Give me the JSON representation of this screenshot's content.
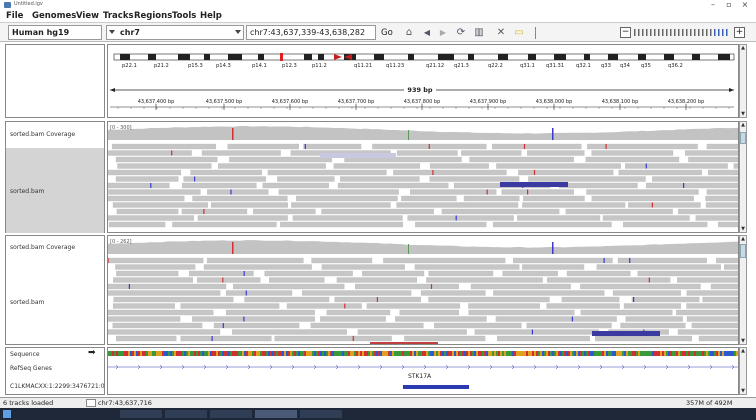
{
  "window": {
    "title": "Untitled.igv"
  },
  "menu": [
    "File",
    "Genomes",
    "View",
    "Tracks",
    "Regions",
    "Tools",
    "Help"
  ],
  "toolbar": {
    "genome": "Human hg19",
    "chromosome": "chr7",
    "locus": "chr7:43,637,339-43,638,282",
    "go_label": "Go"
  },
  "ideogram": {
    "bands": [
      "p22.1",
      "p21.2",
      "p15.3",
      "p14.3",
      "p14.1",
      "p12.3",
      "p11.2",
      "q11.21",
      "q11.23",
      "q21.12",
      "q21.3",
      "q22.2",
      "q31.1",
      "q31.31",
      "q32.1",
      "q33",
      "q34",
      "q35",
      "q36.2"
    ]
  },
  "ruler": {
    "span": "939 bp",
    "ticks": [
      "43,637,400 bp",
      "43,637,500 bp",
      "43,637,600 bp",
      "43,637,700 bp",
      "43,637,800 bp",
      "43,637,900 bp",
      "43,638,000 bp",
      "43,638,100 bp",
      "43,638,200 bp"
    ]
  },
  "panels": [
    {
      "coverage_label": "sorted.bam Coverage",
      "range": "[0 - 300]",
      "alignments_label": "sorted.bam"
    },
    {
      "coverage_label": "sorted.bam Coverage",
      "range": "[0 - 262]",
      "alignments_label": "sorted.bam"
    }
  ],
  "feature_tracks": {
    "sequence": "Sequence",
    "refseq": "RefSeq Genes",
    "other": "C1LKMACXX:1:2299:3476721:0",
    "gene_name": "STK17A"
  },
  "status": {
    "tracks_loaded": "6 tracks loaded",
    "position": "chr7:43,637,716",
    "memory": "357M of 492M"
  },
  "colors": {
    "coverage": "#c3c3c3",
    "read": "#c6c6c6",
    "mismatch_red": "#d03030",
    "reverse_read_blue": "#3a3aa0",
    "gene_blue": "#2a3ab0"
  }
}
